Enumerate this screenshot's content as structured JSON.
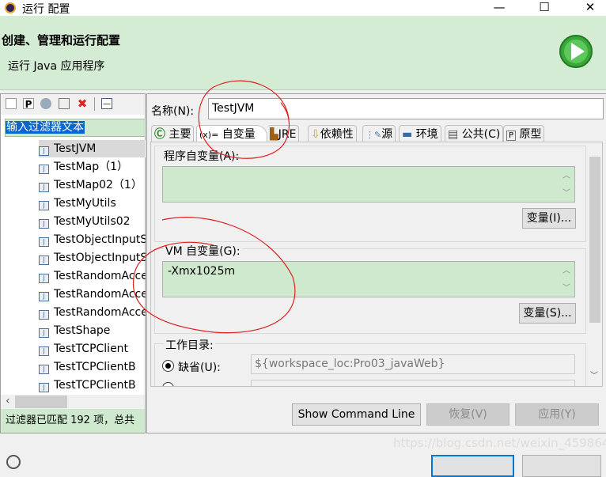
{
  "window": {
    "title": "运行 配置",
    "minimize": "—",
    "maximize": "☐",
    "close": "✕"
  },
  "header": {
    "title": "创建、管理和运行配置",
    "subtitle": "运行 Java 应用程序"
  },
  "left": {
    "filter_text": "输入过滤器文本",
    "items": [
      "TestJVM",
      "TestMap（1）",
      "TestMap02（1）",
      "TestMyUtils",
      "TestMyUtils02",
      "TestObjectInputStream",
      "TestObjectInputStream",
      "TestRandomAccessFile",
      "TestRandomAccessFile",
      "TestRandomAccessFile",
      "TestShape",
      "TestTCPClient",
      "TestTCPClientB",
      "TestTCPClientB"
    ],
    "selected": 0,
    "status": "过滤器已匹配 192 项，总共"
  },
  "right": {
    "name_label": "名称(N):",
    "name_value": "TestJVM",
    "tabs": [
      "主要",
      "自变量",
      "JRE",
      "依赖性",
      "源",
      "环境",
      "公共(C)",
      "原型"
    ],
    "active_tab": 1,
    "program_args_label": "程序自变量(A):",
    "program_args_value": "",
    "variables_1": "变量(I)...",
    "vm_args_label": "VM 自变量(G):",
    "vm_args_value": "-Xmx1025m",
    "variables_2": "变量(S)...",
    "workdir_label": "工作目录:",
    "default_label": "缺省(U):",
    "default_value": "${workspace_loc:Pro03_javaWeb}",
    "show_command_line": "Show Command Line",
    "revert": "恢复(V)",
    "apply": "应用(Y)"
  },
  "watermark": "https://blog.csdn.net/weixin_45986454",
  "colors": {
    "header": "#d3ecd3",
    "field": "#cfe9cf",
    "selection": "#0a64d2",
    "annotation": "#e02020"
  }
}
